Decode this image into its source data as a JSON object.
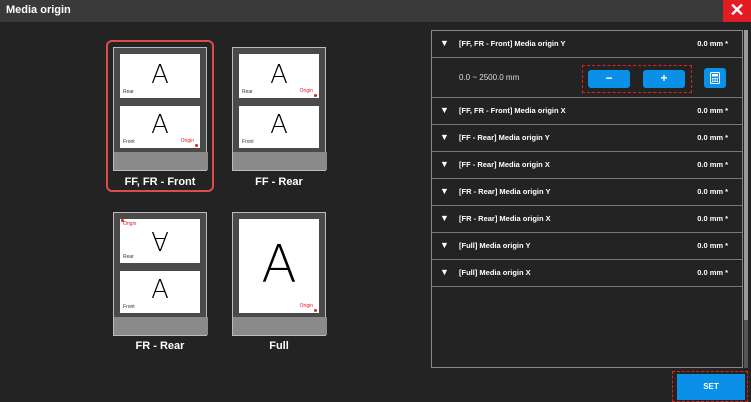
{
  "window": {
    "title": "Media origin",
    "close_glyph": "✕"
  },
  "thumbnails": [
    {
      "id": "ff-fr-front",
      "caption": "FF, FR - Front",
      "selected": true,
      "top_paper": {
        "letter": "A",
        "side_label": "Rear",
        "origin_label": ""
      },
      "bottom_paper": {
        "letter": "A",
        "side_label": "Front",
        "origin_label": "Origin"
      }
    },
    {
      "id": "ff-rear",
      "caption": "FF - Rear",
      "selected": false,
      "top_paper": {
        "letter": "A",
        "side_label": "Rear",
        "origin_label": "Origin"
      },
      "bottom_paper": {
        "letter": "A",
        "side_label": "Front",
        "origin_label": ""
      }
    },
    {
      "id": "fr-rear",
      "caption": "FR - Rear",
      "selected": false,
      "top_paper": {
        "letter": "A",
        "side_label": "Rear",
        "origin_label": "Origin"
      },
      "bottom_paper": {
        "letter": "A",
        "side_label": "Front",
        "origin_label": ""
      }
    },
    {
      "id": "full",
      "caption": "Full",
      "selected": false,
      "full_paper": {
        "letter": "A",
        "origin_label": "Origin"
      }
    }
  ],
  "settings": {
    "expanded": {
      "label": "[FF, FR - Front] Media origin Y",
      "value": "0.0 mm",
      "marker": "*",
      "range": "0.0 ~ 2500.0 mm",
      "minus_label": "−",
      "plus_label": "+"
    },
    "rows": [
      {
        "label": "[FF, FR - Front] Media origin X",
        "value": "0.0 mm",
        "marker": "*"
      },
      {
        "label": "[FF - Rear] Media origin Y",
        "value": "0.0 mm",
        "marker": "*"
      },
      {
        "label": "[FF - Rear] Media origin X",
        "value": "0.0 mm",
        "marker": "*"
      },
      {
        "label": "[FR - Rear] Media origin Y",
        "value": "0.0 mm",
        "marker": "*"
      },
      {
        "label": "[FR - Rear] Media origin X",
        "value": "0.0 mm",
        "marker": "*"
      },
      {
        "label": "[Full] Media origin Y",
        "value": "0.0 mm",
        "marker": "*"
      },
      {
        "label": "[Full] Media origin X",
        "value": "0.0 mm",
        "marker": "*"
      }
    ],
    "arrow_glyph": "▼"
  },
  "footer": {
    "set_label": "SET"
  },
  "colors": {
    "accent": "#0a90e6",
    "highlight": "#e02020",
    "selection": "#e04a4a",
    "background": "#232323"
  }
}
